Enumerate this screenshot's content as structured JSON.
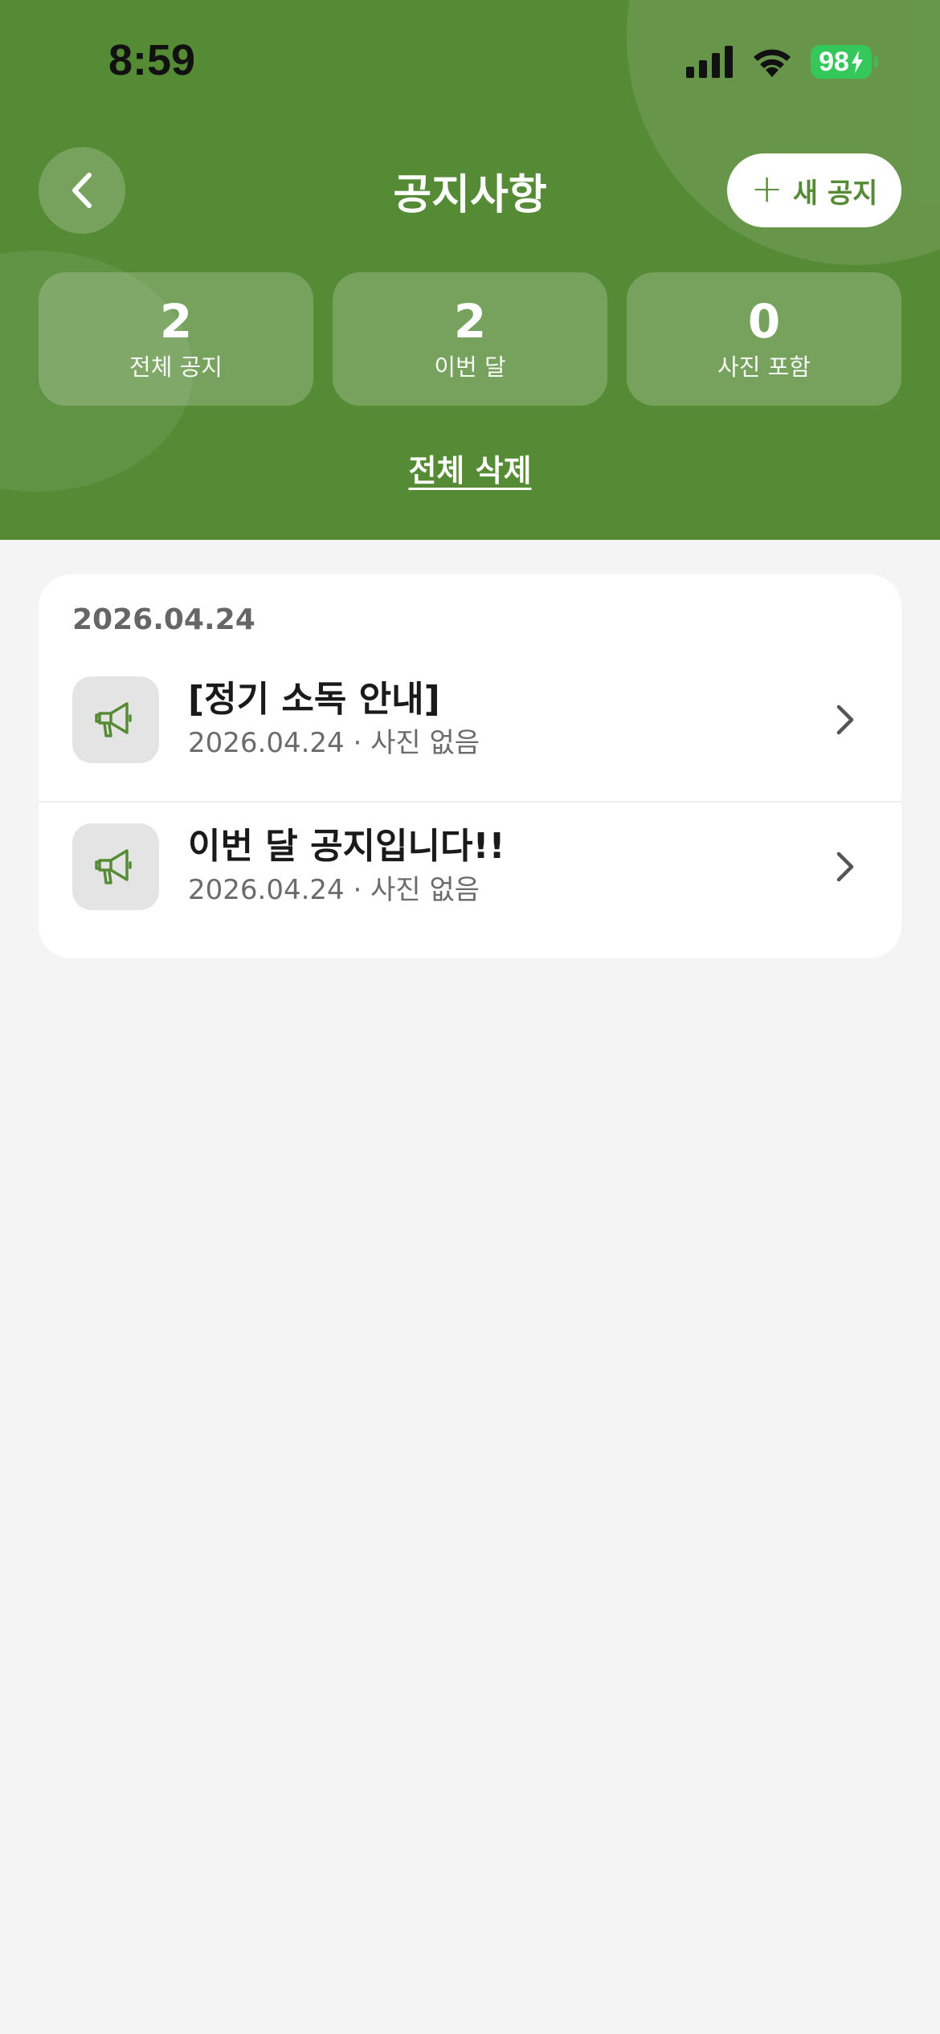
{
  "status_bar": {
    "time": "8:59",
    "battery": "98"
  },
  "header": {
    "title": "공지사항",
    "new_button_label": "새 공지",
    "delete_all_label": "전체 삭제"
  },
  "stats": [
    {
      "value": "2",
      "label": "전체 공지"
    },
    {
      "value": "2",
      "label": "이번 달"
    },
    {
      "value": "0",
      "label": "사진 포함"
    }
  ],
  "groups": [
    {
      "date": "2026.04.24",
      "items": [
        {
          "title": "[정기 소독 안내]",
          "meta": "2026.04.24 · 사진 없음"
        },
        {
          "title": "이번 달 공지입니다!!",
          "meta": "2026.04.24 · 사진 없음"
        }
      ]
    }
  ],
  "colors": {
    "brand": "#568b36",
    "background": "#f4f4f4",
    "battery": "#34c759"
  },
  "icons": [
    "back-chevron-icon",
    "plus-icon",
    "megaphone-icon",
    "chevron-right-icon"
  ]
}
